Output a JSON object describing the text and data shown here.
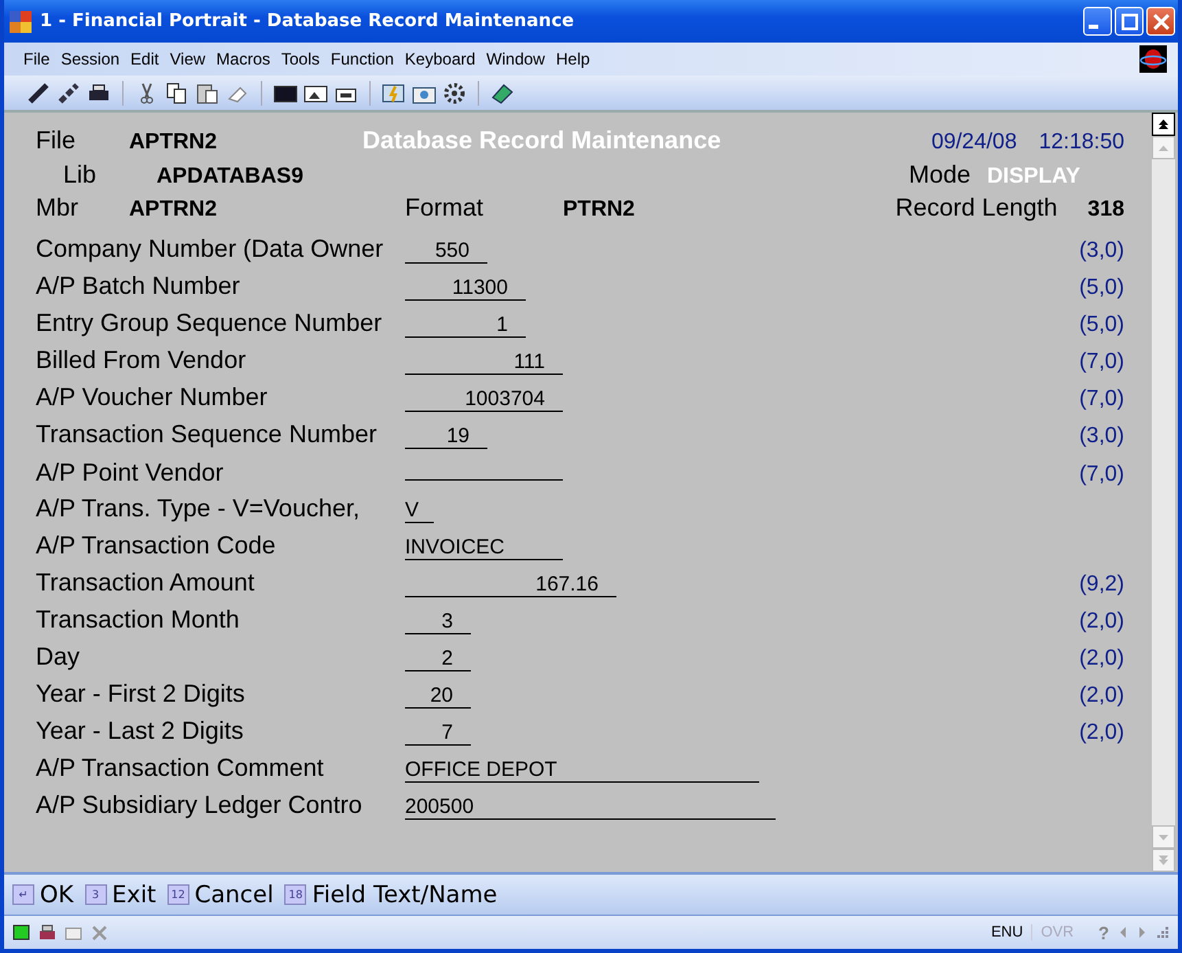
{
  "window": {
    "title": "1 - Financial Portrait - Database Record Maintenance"
  },
  "menu": [
    "File",
    "Session",
    "Edit",
    "View",
    "Macros",
    "Tools",
    "Function",
    "Keyboard",
    "Window",
    "Help"
  ],
  "header": {
    "file_label": "File",
    "file": "APTRN2",
    "title": "Database Record Maintenance",
    "date": "09/24/08",
    "time": "12:18:50",
    "lib_label": "Lib",
    "lib": "APDATABAS9",
    "mode_label": "Mode",
    "mode": "DISPLAY",
    "mbr_label": "Mbr",
    "mbr": "APTRN2",
    "format_label": "Format",
    "format": "PTRN2",
    "reclen_label": "Record Length",
    "reclen": "318"
  },
  "fields": [
    {
      "label": "Company Number (Data Owner",
      "value": "550",
      "length": "(3,0)"
    },
    {
      "label": "A/P Batch Number",
      "value": "11300",
      "length": "(5,0)"
    },
    {
      "label": "Entry Group Sequence Number",
      "value": "1",
      "length": "(5,0)"
    },
    {
      "label": "Billed From Vendor",
      "value": "111",
      "length": "(7,0)"
    },
    {
      "label": "A/P Voucher Number",
      "value": "1003704",
      "length": "(7,0)"
    },
    {
      "label": "Transaction Sequence Number",
      "value": "19",
      "length": "(3,0)"
    },
    {
      "label": "A/P Point Vendor",
      "length": "(7,0)"
    },
    {
      "label": "A/P Trans. Type - V=Voucher,",
      "value": "V"
    },
    {
      "label": "A/P Transaction Code",
      "value": "INVOICEC"
    },
    {
      "label": "Transaction Amount",
      "value": "167.16",
      "length": "(9,2)"
    },
    {
      "label": "Transaction Month",
      "value": "3",
      "length": "(2,0)"
    },
    {
      "label": "Day",
      "value": "2",
      "length": "(2,0)"
    },
    {
      "label": "Year - First 2 Digits",
      "value": "20",
      "length": "(2,0)"
    },
    {
      "label": "Year - Last 2 Digits",
      "value": "7",
      "length": "(2,0)"
    },
    {
      "label": "A/P Transaction Comment",
      "value": "OFFICE DEPOT"
    },
    {
      "label": "A/P Subsidiary Ledger Contro",
      "value": "200500"
    }
  ],
  "function_keys": [
    {
      "key": "↵",
      "label": "OK"
    },
    {
      "key": "3",
      "label": "Exit"
    },
    {
      "key": "12",
      "label": "Cancel"
    },
    {
      "key": "18",
      "label": "Field Text/Name"
    }
  ],
  "status_bar": {
    "language": "ENU",
    "overwrite": "OVR",
    "help": "?"
  }
}
